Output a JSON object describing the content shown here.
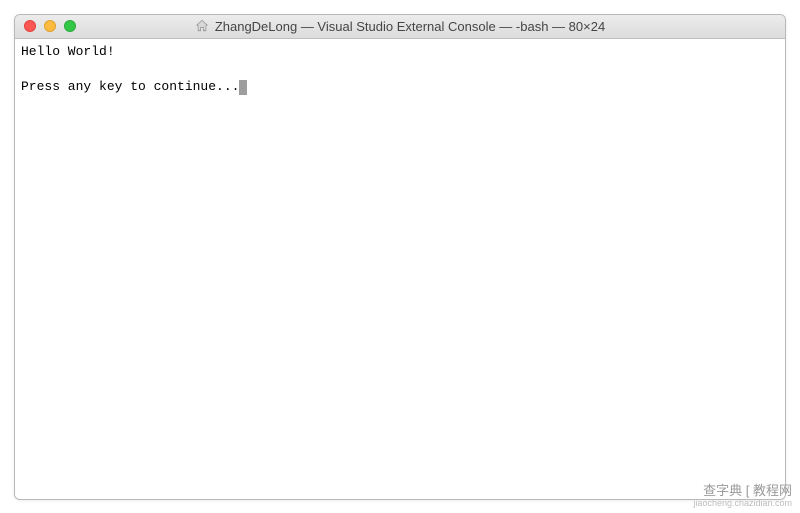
{
  "titlebar": {
    "title": "ZhangDeLong — Visual Studio External Console — -bash — 80×24"
  },
  "terminal": {
    "line1": "Hello World!",
    "line2": "Press any key to continue..."
  },
  "watermark": {
    "main": "查字典 [ 教程网",
    "sub": "jiaocheng.chazidian.com"
  }
}
